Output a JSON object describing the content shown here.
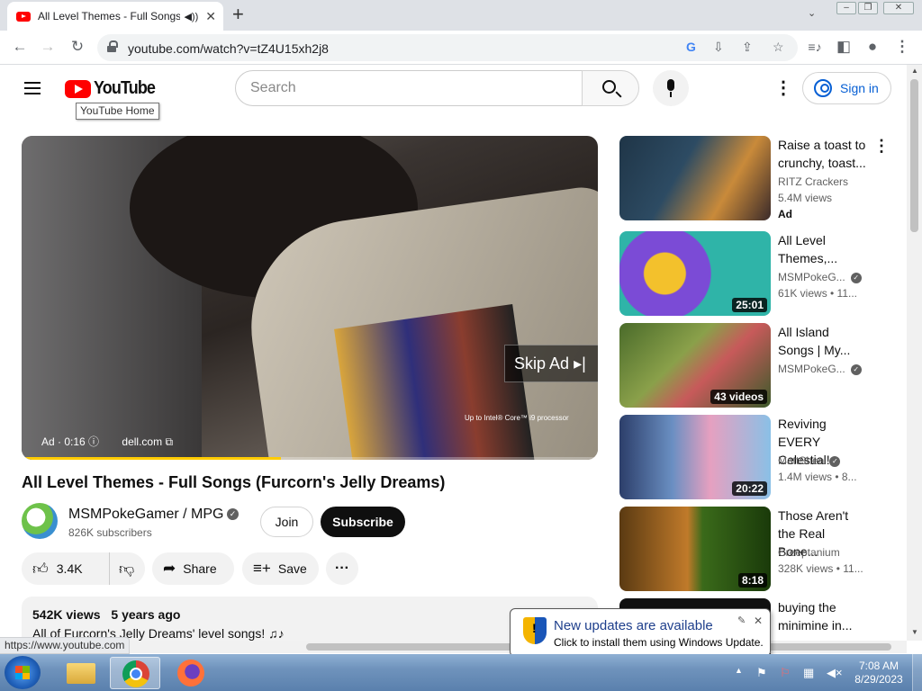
{
  "browser": {
    "tab_title": "All Level Themes - Full Songs",
    "url": "youtube.com/watch?v=tZ4U15xh2j8",
    "status_url": "https://www.youtube.com"
  },
  "header": {
    "logo_text": "YouTube",
    "logo_tooltip": "YouTube Home",
    "search_placeholder": "Search",
    "sign_in": "Sign in"
  },
  "player": {
    "skip_ad": "Skip Ad",
    "overlay_text": "Up to Intel® Core™ i9 processor",
    "ad_label": "Ad · 0:16",
    "ad_domain": "dell.com",
    "progress": 0.45
  },
  "video": {
    "title": "All Level Themes - Full Songs (Furcorn's Jelly Dreams)",
    "channel": "MSMPokeGamer / MPG",
    "subscribers": "826K subscribers",
    "join": "Join",
    "subscribe": "Subscribe",
    "likes": "3.4K",
    "share": "Share",
    "save": "Save",
    "views": "542K views",
    "age": "5 years ago",
    "description": "All of Furcorn's Jelly Dreams' level songs! ♫♪"
  },
  "recommendations": [
    {
      "title": "Raise a toast to\ncrunchy, toast...",
      "channel": "RITZ Crackers",
      "meta": "5.4M views",
      "badge": "Ad",
      "duration": "",
      "verified": false
    },
    {
      "title": "All Level\nThemes,...",
      "channel": "MSMPokeG...",
      "meta": "61K views  •  11...",
      "badge": "",
      "duration": "25:01",
      "verified": true
    },
    {
      "title": "All Island\nSongs | My...",
      "channel": "MSMPokeG...",
      "meta": "",
      "badge": "",
      "duration": "43 videos",
      "verified": true
    },
    {
      "title": "Reviving EVERY\nCelestial!...",
      "channel": "MattShea",
      "meta": "1.4M views  •  8...",
      "badge": "",
      "duration": "20:22",
      "verified": true
    },
    {
      "title": "Those Aren't\nthe Real Bone...",
      "channel": "Creeptanium",
      "meta": "328K views  •  11...",
      "badge": "",
      "duration": "8:18",
      "verified": false
    },
    {
      "title": "buying the\nminimine in...",
      "channel": "",
      "meta": "",
      "badge": "",
      "duration": "",
      "verified": false
    }
  ],
  "notification": {
    "title": "New updates are available",
    "body": "Click to install them using Windows Update."
  },
  "taskbar": {
    "time": "7:08 AM",
    "date": "8/29/2023"
  }
}
